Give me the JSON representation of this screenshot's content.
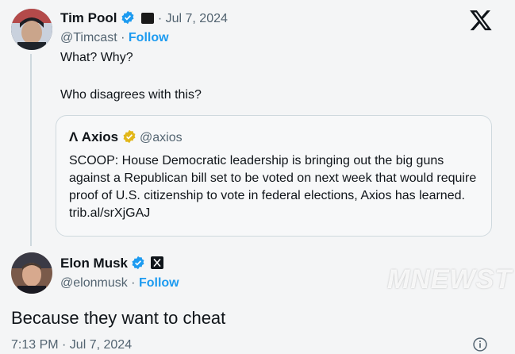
{
  "tweet1": {
    "name": "Tim Pool",
    "date": "· Jul 7, 2024",
    "handle": "@Timcast",
    "follow": "Follow",
    "line1": "What? Why?",
    "line2": "Who disagrees with this?"
  },
  "quote": {
    "name": "Axios",
    "handle": "@axios",
    "text": "SCOOP: House Democratic leadership is bringing out the big guns against a Republican bill set to be voted on next week that would require proof of U.S. citizenship to vote in federal elections, Axios has learned. trib.al/srXjGAJ"
  },
  "tweet2": {
    "name": "Elon Musk",
    "handle": "@elonmusk",
    "sep": "·",
    "follow": "Follow",
    "text": "Because they want to cheat",
    "timestamp": "7:13 PM · Jul 7, 2024"
  },
  "watermark": "MNEWST",
  "colors": {
    "accent": "#1d9bf0",
    "gold": "#e2b719",
    "muted": "#536471"
  },
  "icons": [
    "x-logo-icon",
    "verified-blue-icon",
    "verified-gold-icon",
    "info-icon"
  ]
}
